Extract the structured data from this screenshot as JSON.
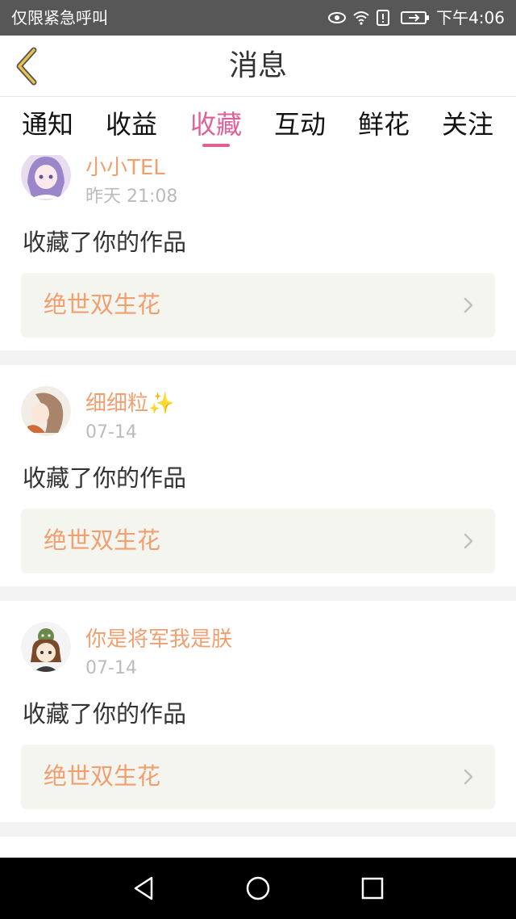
{
  "status_bar": {
    "carrier_text": "仅限紧急呼叫",
    "time": "下午4:06",
    "icons": [
      "eye-icon",
      "wifi-icon",
      "alert-icon",
      "battery-icon"
    ]
  },
  "header": {
    "back_icon": "chevron-left-icon",
    "title": "消息"
  },
  "tabs": [
    {
      "label": "通知"
    },
    {
      "label": "收益"
    },
    {
      "label": "收藏"
    },
    {
      "label": "互动"
    },
    {
      "label": "鲜花"
    },
    {
      "label": "关注"
    }
  ],
  "active_tab": "收藏",
  "messages": [
    {
      "username": "小小TEL",
      "time": "昨天 21:08",
      "action": "收藏了你的作品",
      "work_title": "绝世双生花"
    },
    {
      "username": "细细粒",
      "username_emoji": "✨",
      "time": "07-14",
      "action": "收藏了你的作品",
      "work_title": "绝世双生花"
    },
    {
      "username": "你是将军我是朕",
      "time": "07-14",
      "action": "收藏了你的作品",
      "work_title": "绝世双生花"
    }
  ],
  "nav_bar": {
    "buttons": [
      "back-triangle-icon",
      "home-circle-icon",
      "recents-square-icon"
    ]
  },
  "colors": {
    "accent": "#e0609a",
    "username": "#f0a070",
    "work_bg": "#f5f5ef",
    "header_back_icon": "#e8c24a"
  }
}
